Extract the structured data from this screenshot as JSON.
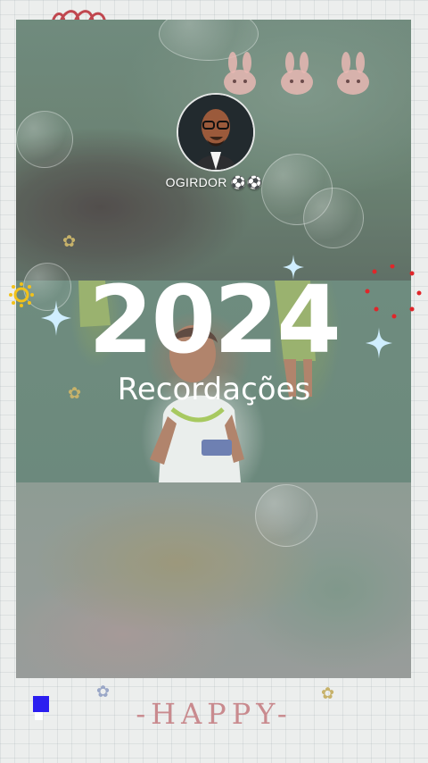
{
  "story": {
    "username": "OGIRDOR ⚽⚽",
    "year": "2024",
    "subtitle": "Recordações",
    "footer_text": "-HAPPY-"
  },
  "icons": {
    "avatar": "memoji-avatar",
    "sparkles": "sparkle-icon",
    "bunnies": "bunny-icon",
    "sun": "sun-doodle-icon",
    "dots": "red-dots-icon"
  },
  "colors": {
    "frame": "#5f7a6d",
    "text": "#ffffff",
    "happy": "#c98a8e",
    "sparkle": "#bfe6ff",
    "dots": "#e0262a"
  }
}
